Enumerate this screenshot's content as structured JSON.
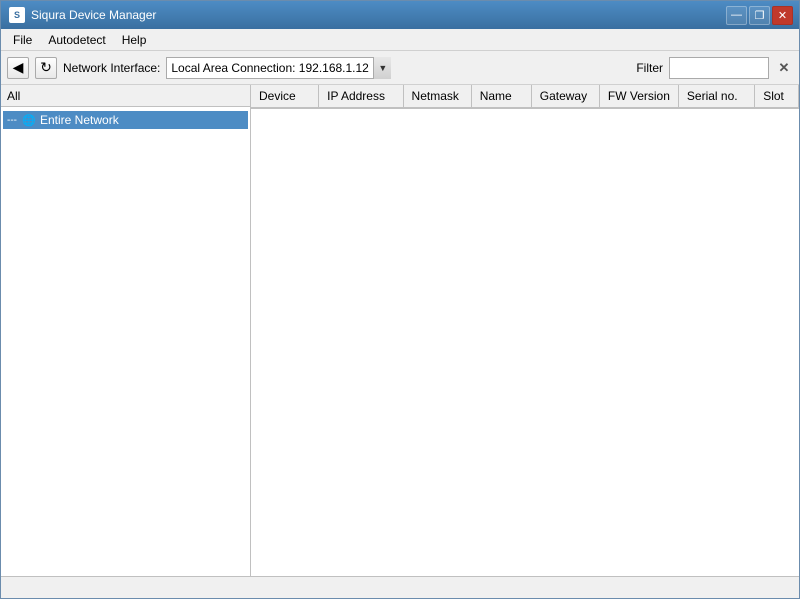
{
  "window": {
    "title": "Siqura Device Manager",
    "icon_label": "S"
  },
  "title_buttons": {
    "minimize": "—",
    "restore": "❐",
    "close": "✕"
  },
  "menu": {
    "items": [
      "File",
      "Autodetect",
      "Help"
    ]
  },
  "toolbar": {
    "network_interface_label": "Network Interface:",
    "network_interface_value": "Local Area Connection: 192.168.1.12",
    "network_options": [
      "Local Area Connection: 192.168.1.12"
    ],
    "filter_label": "Filter",
    "filter_value": "",
    "filter_placeholder": "",
    "refresh_icon": "↻",
    "back_icon": "◀"
  },
  "left_panel": {
    "header": "All",
    "tree": [
      {
        "id": "entire-network",
        "label": "Entire Network",
        "icon": "🌐",
        "selected": true,
        "expander": "---"
      }
    ]
  },
  "table": {
    "columns": [
      {
        "id": "device",
        "label": "Device"
      },
      {
        "id": "ip",
        "label": "IP Address"
      },
      {
        "id": "netmask",
        "label": "Netmask"
      },
      {
        "id": "name",
        "label": "Name"
      },
      {
        "id": "gateway",
        "label": "Gateway"
      },
      {
        "id": "fw_version",
        "label": "FW Version"
      },
      {
        "id": "serial",
        "label": "Serial no."
      },
      {
        "id": "slot",
        "label": "Slot"
      }
    ],
    "rows": []
  },
  "colors": {
    "titlebar_start": "#4d8cc4",
    "titlebar_end": "#3a6fa0",
    "selected_bg": "#4d8cc4",
    "close_btn": "#c0392b"
  }
}
